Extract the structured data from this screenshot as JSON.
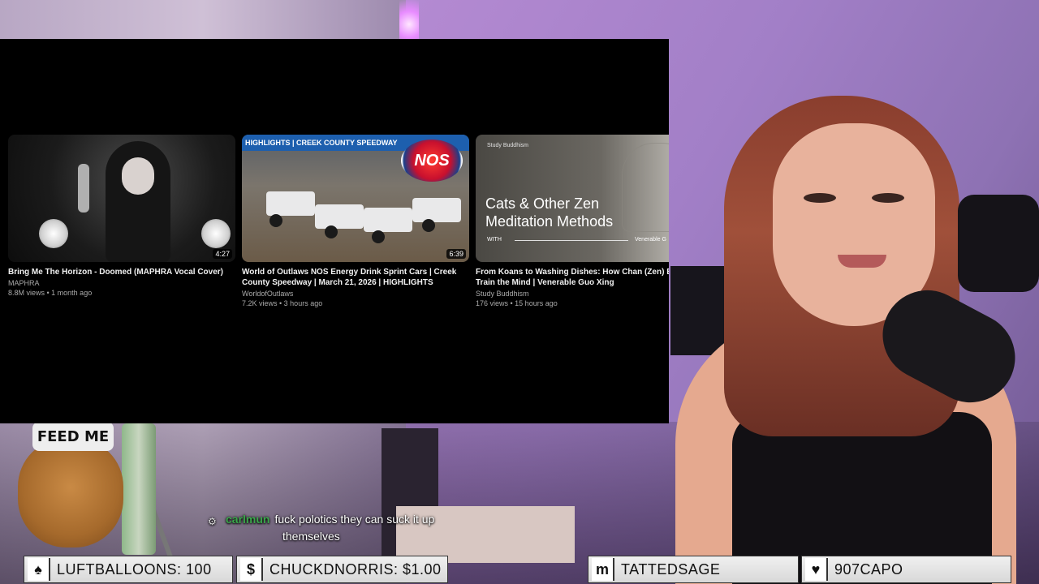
{
  "videos": [
    {
      "title": "Bring Me The Horizon - Doomed (MAPHRA Vocal Cover)",
      "channel": "MAPHRA",
      "meta": "8.8M views • 1 month ago",
      "duration": "4:27"
    },
    {
      "title": "World of Outlaws NOS Energy Drink Sprint Cars | Creek County Speedway | March 21, 2026 | HIGHLIGHTS",
      "channel": "WorldofOutlaws",
      "meta": "7.2K views • 3 hours ago",
      "duration": "6:39",
      "banner": "HIGHLIGHTS | CREEK COUNTY SPEEDWAY",
      "logo_text": "NOS"
    },
    {
      "title": "From Koans to Washing Dishes: How Chan (Zen) Buddhism Can Train the Mind | Venerable Guo Xing",
      "channel": "Study Buddhism",
      "meta": "176 views • 15 hours ago",
      "thumb_small": "Study Buddhism",
      "thumb_big": "Cats & Other Zen Meditation Methods",
      "thumb_with": "WITH",
      "thumb_ven": "Venerable G"
    }
  ],
  "overlay": {
    "dog_hat": "FEED ME",
    "chat": {
      "username": "carlmun",
      "message_line1": "fuck polotics they can suck it up",
      "message_line2": "themselves"
    }
  },
  "bottom_bar": [
    {
      "icon": "spade-icon",
      "glyph": "♠",
      "text": "LUFTBALLOONS: 100"
    },
    {
      "icon": "dollar-icon",
      "glyph": "$",
      "text": "CHUCKDNORRIS: $1.00"
    },
    {
      "icon": "m-icon",
      "glyph": "m",
      "text": "TATTEDSAGE"
    },
    {
      "icon": "heart-icon",
      "glyph": "♥",
      "text": "907CAPO"
    }
  ],
  "colors": {
    "chat_username": "#3aa64a",
    "banner_blue": "#1d5fae",
    "panel_bg": "#000000"
  }
}
